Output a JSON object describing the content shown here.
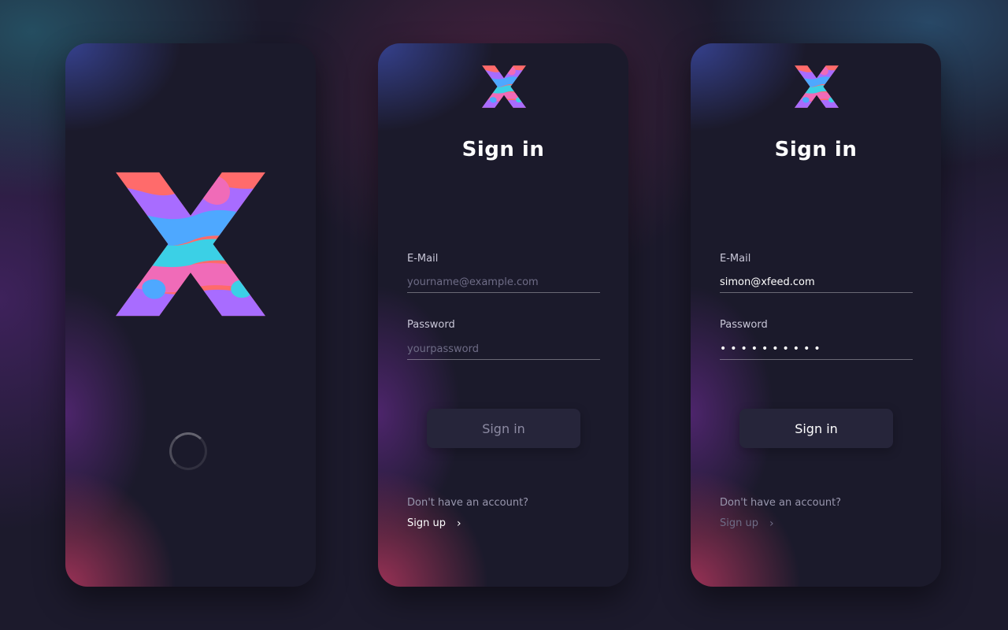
{
  "colors": {
    "background": "#1c1a2c",
    "card": "#1b1a2b",
    "button": "#26253a",
    "logo_palette": [
      "#ff6b6b",
      "#a86cff",
      "#4ea8ff",
      "#3bd0e6",
      "#f06bb8"
    ]
  },
  "screens": [
    {
      "type": "splash",
      "logo_icon": "x-logo-icon",
      "spinner_icon": "loading-spinner-icon"
    },
    {
      "type": "sign-in-empty",
      "logo_icon": "x-logo-icon",
      "title": "Sign in",
      "email": {
        "label": "E-Mail",
        "value": "",
        "placeholder": "yourname@example.com"
      },
      "password": {
        "label": "Password",
        "value": "",
        "placeholder": "yourpassword"
      },
      "submit_label": "Sign in",
      "submit_state": "disabled",
      "no_account_text": "Don't have an account?",
      "signup_label": "Sign up",
      "chevron_icon": "chevron-right-icon",
      "chevron_glyph": "›"
    },
    {
      "type": "sign-in-filled",
      "logo_icon": "x-logo-icon",
      "title": "Sign in",
      "email": {
        "label": "E-Mail",
        "value": "simon@xfeed.com",
        "placeholder": "yourname@example.com"
      },
      "password": {
        "label": "Password",
        "value": "••••••••••",
        "placeholder": "yourpassword"
      },
      "submit_label": "Sign in",
      "submit_state": "enabled",
      "no_account_text": "Don't have an account?",
      "signup_label": "Sign up",
      "chevron_icon": "chevron-right-icon",
      "chevron_glyph": "›"
    }
  ]
}
